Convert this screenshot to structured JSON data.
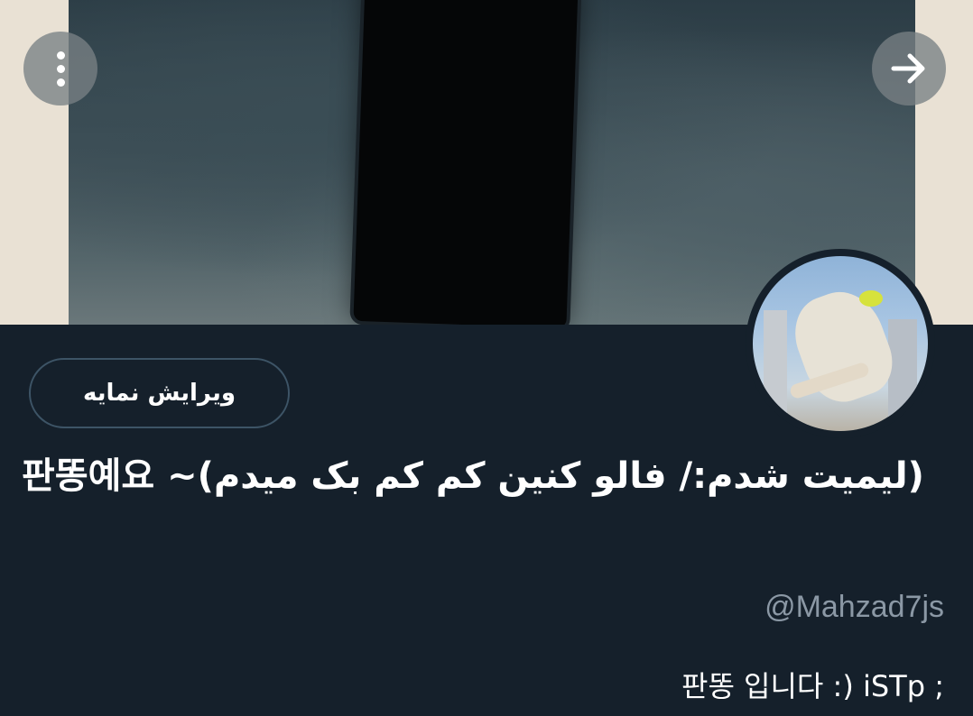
{
  "header": {
    "more_icon": "more-vertical-icon",
    "next_icon": "arrow-right-icon"
  },
  "profile": {
    "edit_button_label": "ویرایش نمایه",
    "display_name": "판똥예요 ~(لیمیت شدم:/ فالو کنین کم کم بک میدم)",
    "handle": "@Mahzad7js",
    "bio": "판똥 입니다 :) iSTp ;"
  },
  "colors": {
    "background": "#15202b",
    "secondary_text": "#8b98a5",
    "button_border": "#3d5466"
  }
}
